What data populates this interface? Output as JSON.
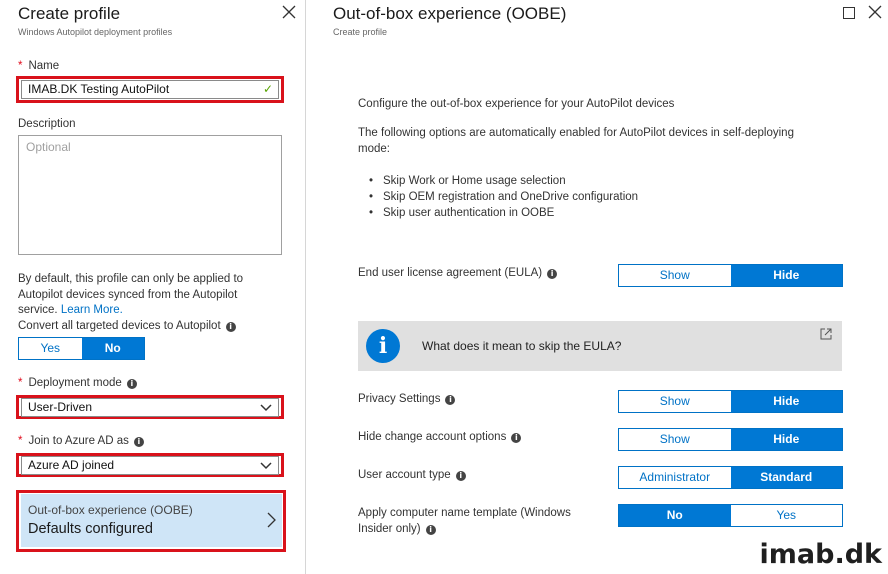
{
  "left": {
    "title": "Create profile",
    "subtitle": "Windows Autopilot deployment profiles",
    "name_label": "Name",
    "name_value": "IMAB.DK Testing AutoPilot",
    "description_label": "Description",
    "description_placeholder": "Optional",
    "info_text": "By default, this profile can only be applied to Autopilot devices synced from the Autopilot service.",
    "learn_more": "Learn More.",
    "convert_label": "Convert all targeted devices to Autopilot",
    "convert_options": [
      "Yes",
      "No"
    ],
    "convert_selected": "No",
    "deployment_mode_label": "Deployment mode",
    "deployment_mode_value": "User-Driven",
    "join_label": "Join to Azure AD as",
    "join_value": "Azure AD joined",
    "oobe_tile_title": "Out-of-box experience (OOBE)",
    "oobe_tile_value": "Defaults configured"
  },
  "right": {
    "title": "Out-of-box experience (OOBE)",
    "subtitle": "Create profile",
    "intro": "Configure the out-of-box experience for your AutoPilot devices",
    "auto_enabled_line1": "The following options are automatically enabled for AutoPilot devices in self-deploying",
    "auto_enabled_line2": "mode:",
    "bullets": [
      "Skip Work or Home usage selection",
      "Skip OEM registration and OneDrive configuration",
      "Skip user authentication in OOBE"
    ],
    "eula": {
      "label": "End user license agreement (EULA)",
      "options": [
        "Show",
        "Hide"
      ],
      "selected": "Hide"
    },
    "eula_info": "What does it mean to skip the EULA?",
    "privacy": {
      "label": "Privacy Settings",
      "options": [
        "Show",
        "Hide"
      ],
      "selected": "Hide"
    },
    "change_account": {
      "label": "Hide change account options",
      "options": [
        "Show",
        "Hide"
      ],
      "selected": "Hide"
    },
    "user_account_type": {
      "label": "User account type",
      "options": [
        "Administrator",
        "Standard"
      ],
      "selected": "Standard"
    },
    "name_template": {
      "label_line1": "Apply computer name template (Windows",
      "label_line2": "Insider only)",
      "options": [
        "No",
        "Yes"
      ],
      "selected": "No"
    }
  },
  "watermark": "imab.dk",
  "colors": {
    "accent": "#0078d4",
    "highlight": "#d9121b",
    "tile": "#cfe5f7",
    "valid": "#57a300"
  }
}
